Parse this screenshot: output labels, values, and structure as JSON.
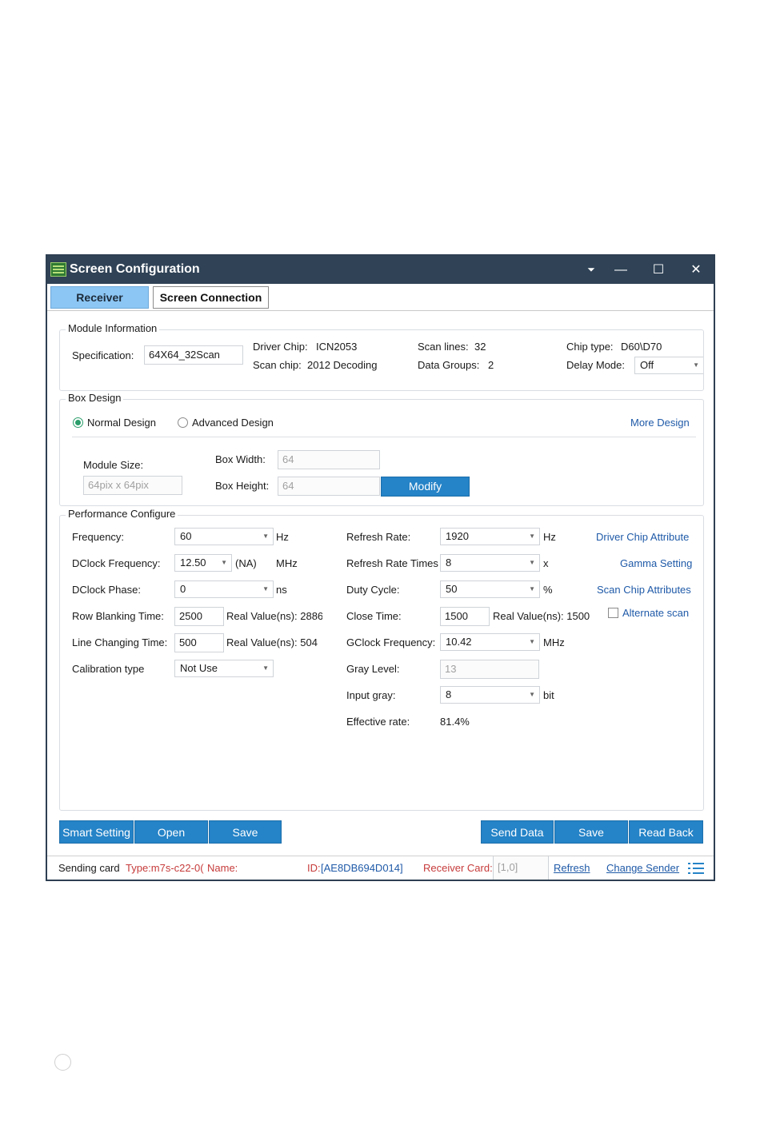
{
  "window": {
    "title": "Screen Configuration",
    "icon": "led-screen-icon"
  },
  "titlebar": {
    "menu_glyph": "⏷",
    "min_glyph": "—",
    "max_glyph": "☐",
    "close_glyph": "✕"
  },
  "tabs": [
    {
      "label": "Receiver",
      "active": true
    },
    {
      "label": "Screen Connection",
      "active": false
    }
  ],
  "module_info": {
    "legend": "Module Information",
    "spec_label": "Specification:",
    "spec_value": "64X64_32Scan",
    "driver_chip_label": "Driver Chip:",
    "driver_chip_value": "ICN2053",
    "scan_chip_label": "Scan chip:",
    "scan_chip_value": "2012 Decoding",
    "scan_lines_label": "Scan lines:",
    "scan_lines_value": "32",
    "data_groups_label": "Data Groups:",
    "data_groups_value": "2",
    "chip_type_label": "Chip type:",
    "chip_type_value": "D60\\D70",
    "delay_mode_label": "Delay Mode:",
    "delay_mode_value": "Off"
  },
  "box_design": {
    "legend": "Box Design",
    "normal_label": "Normal Design",
    "advanced_label": "Advanced Design",
    "more_design": "More Design",
    "module_size_label": "Module Size:",
    "module_size_value": "64pix x 64pix",
    "box_width_label": "Box Width:",
    "box_width_value": "64",
    "box_height_label": "Box Height:",
    "box_height_value": "64",
    "modify_label": "Modify"
  },
  "performance": {
    "legend": "Performance Configure",
    "frequency_label": "Frequency:",
    "frequency_value": "60",
    "frequency_unit": "Hz",
    "dclock_label": "DClock Frequency:",
    "dclock_value": "12.50",
    "dclock_na": "(NA)",
    "dclock_unit": "MHz",
    "dphase_label": "DClock Phase:",
    "dphase_value": "0",
    "dphase_unit": "ns",
    "row_blank_label": "Row Blanking Time:",
    "row_blank_value": "2500",
    "row_blank_real": "Real Value(ns): 2886",
    "line_change_label": "Line Changing Time:",
    "line_change_value": "500",
    "line_change_real": "Real Value(ns): 504",
    "calib_label": "Calibration type",
    "calib_value": "Not Use",
    "refresh_label": "Refresh Rate:",
    "refresh_value": "1920",
    "refresh_unit": "Hz",
    "refresh_times_label": "Refresh Rate Times",
    "refresh_times_value": "8",
    "refresh_times_unit": "x",
    "duty_label": "Duty Cycle:",
    "duty_value": "50",
    "duty_unit": "%",
    "close_label": "Close Time:",
    "close_value": "1500",
    "close_real": "Real Value(ns): 1500",
    "gclock_label": "GClock Frequency:",
    "gclock_value": "10.42",
    "gclock_unit": "MHz",
    "gray_label": "Gray Level:",
    "gray_value": "13",
    "input_gray_label": "Input gray:",
    "input_gray_value": "8",
    "input_gray_unit": "bit",
    "effective_label": "Effective rate:",
    "effective_value": "81.4%",
    "driver_chip_attr": "Driver Chip Attribute",
    "gamma_setting": "Gamma Setting",
    "scan_chip_attr": "Scan Chip Attributes",
    "alternate_scan": "Alternate scan"
  },
  "buttons": {
    "smart_setting": "Smart Setting",
    "open": "Open",
    "save_left": "Save",
    "send_data": "Send Data",
    "save_right": "Save",
    "read_back": "Read Back"
  },
  "status": {
    "sending_card": "Sending card",
    "type": "Type:m7s-c22-0(",
    "name": "Name:",
    "id_label": "ID:",
    "id_value": "[AE8DB694D014]",
    "receiver_card_label": "Receiver Card:",
    "receiver_card_value": "[1,0]",
    "refresh": "Refresh",
    "change_sender": "Change Sender"
  },
  "colors": {
    "accent": "#2583c7",
    "titlebar": "#2f4256",
    "tab_active": "#8cc6f4",
    "link": "#1f5aa8",
    "status_red": "#c73b3b"
  }
}
